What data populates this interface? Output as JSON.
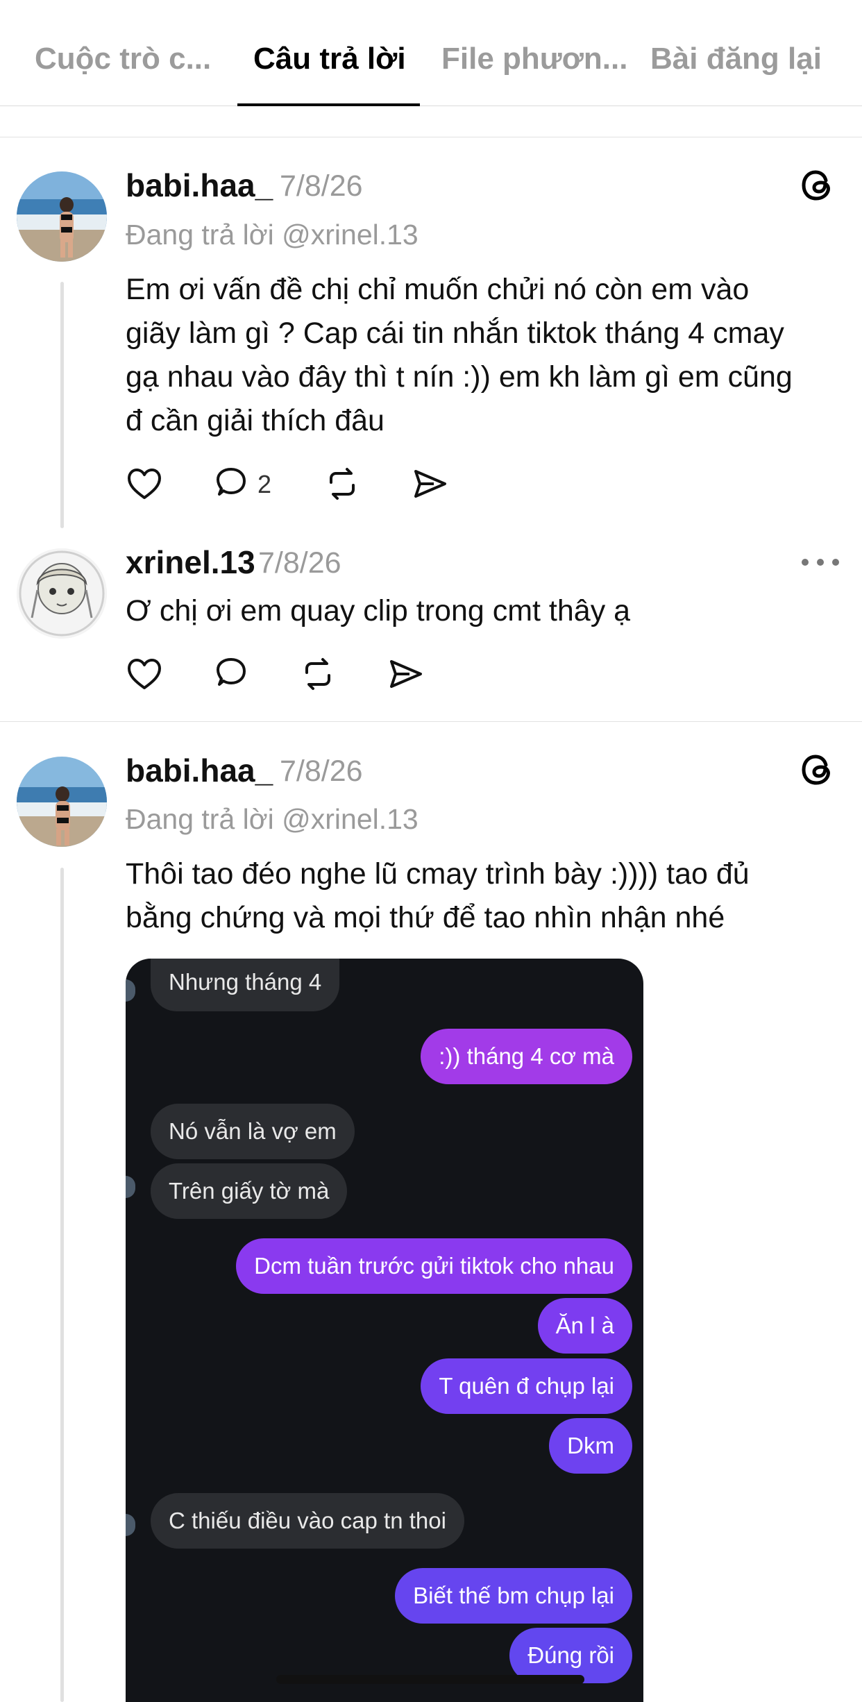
{
  "tabs": [
    {
      "label": "Cuộc trò c..."
    },
    {
      "label": "Câu trả lời"
    },
    {
      "label": "File phươn..."
    },
    {
      "label": "Bài đăng lại"
    }
  ],
  "posts": [
    {
      "username": "babi.haa_",
      "date": "7/8/26",
      "replying_to": "Đang trả lời @xrinel.13",
      "lines": [
        "Em ơi vấn đề chị chỉ muốn chửi nó còn em vào",
        "giãy làm gì ? Cap cái tin nhắn tiktok tháng 4 cmay",
        "gạ nhau vào đây thì t nín :)) em kh làm gì em cũng",
        "đ cần giải thích đâu"
      ],
      "reply_count": "2"
    },
    {
      "username": "xrinel.13",
      "date": "7/8/26",
      "lines": [
        "Ơ chị ơi em quay clip trong cmt thây ạ"
      ]
    },
    {
      "username": "babi.haa_",
      "date": "7/8/26",
      "replying_to": "Đang trả lời @xrinel.13",
      "lines": [
        "Thôi tao đéo nghe lũ cmay trình bày :)))) tao đủ",
        "bằng chứng và mọi thứ để tao nhìn nhận nhé"
      ]
    }
  ],
  "chat_screenshot": {
    "messages": [
      {
        "side": "in",
        "text": "Nhưng tháng 4"
      },
      {
        "side": "out",
        "text": ":)) tháng 4 cơ mà"
      },
      {
        "side": "in",
        "text": "Nó vẫn là vợ em"
      },
      {
        "side": "in",
        "text": "Trên giấy tờ mà"
      },
      {
        "side": "out",
        "text": "Dcm tuần trước gửi tiktok cho nhau"
      },
      {
        "side": "out",
        "text": "Ăn l à"
      },
      {
        "side": "out",
        "text": "T quên đ chụp lại"
      },
      {
        "side": "out",
        "text": "Dkm"
      },
      {
        "side": "in",
        "text": "C thiếu điều vào cap tn thoi"
      },
      {
        "side": "out",
        "text": "Biết thế bm chụp lại"
      },
      {
        "side": "out",
        "text": "Đúng rồi"
      }
    ],
    "colors": {
      "background": "#121418",
      "incoming": "#2b2d31",
      "outgoing": "#7b3cf0"
    }
  },
  "icons": [
    "threads-icon",
    "heart-icon",
    "comment-icon",
    "repost-icon",
    "share-icon",
    "more-icon"
  ]
}
